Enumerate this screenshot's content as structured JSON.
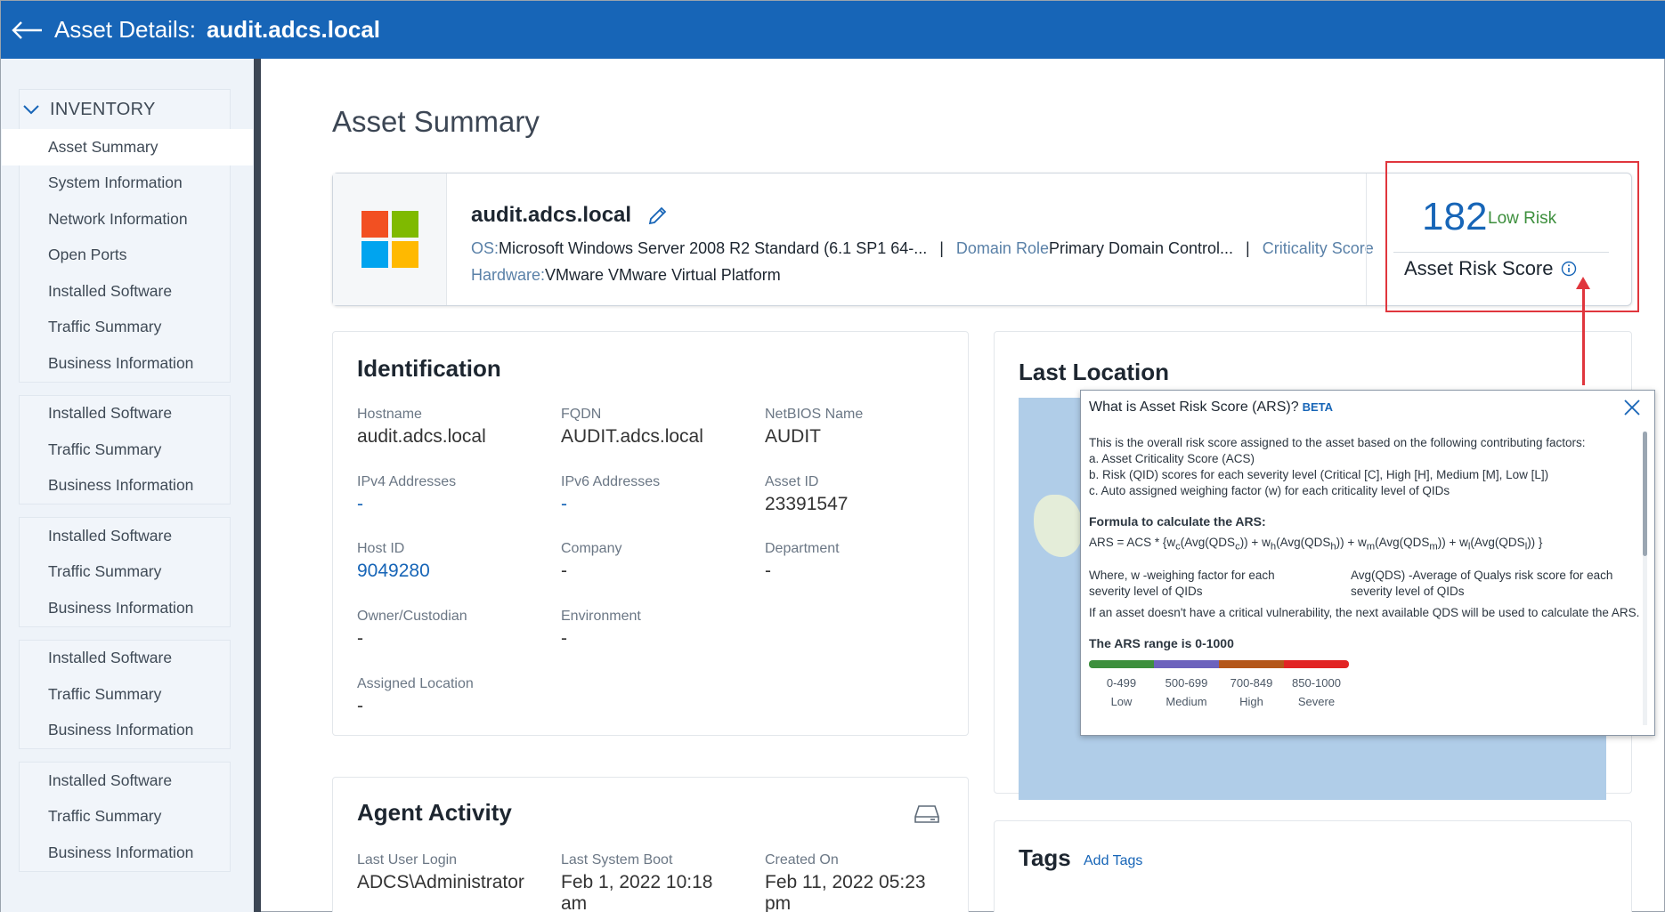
{
  "header": {
    "title": "Asset Details:",
    "host": "audit.adcs.local"
  },
  "sidebar": {
    "section": "INVENTORY",
    "primary": [
      "Asset Summary",
      "System Information",
      "Network Information",
      "Open Ports",
      "Installed Software",
      "Traffic Summary",
      "Business Information"
    ],
    "repeats": [
      [
        "Installed Software",
        "Traffic Summary",
        "Business Information"
      ],
      [
        "Installed Software",
        "Traffic Summary",
        "Business Information"
      ],
      [
        "Installed Software",
        "Traffic Summary",
        "Business Information"
      ],
      [
        "Installed Software",
        "Traffic Summary",
        "Business Information"
      ]
    ]
  },
  "page": {
    "title": "Asset Summary"
  },
  "summary": {
    "name": "audit.adcs.local",
    "os_label": "OS:",
    "os_value": "Microsoft Windows Server 2008 R2 Standard (6.1 SP1 64-...",
    "domain_label": "Domain Role",
    "domain_value": "Primary Domain Control...",
    "criticality_label": "Criticality Score",
    "hw_label": "Hardware:",
    "hw_value": "VMware VMware Virtual Platform",
    "risk_score": "182",
    "risk_level": "Low Risk",
    "risk_label": "Asset Risk Score"
  },
  "identification": {
    "title": "Identification",
    "fields": {
      "hostname": {
        "label": "Hostname",
        "value": "audit.adcs.local"
      },
      "fqdn": {
        "label": "FQDN",
        "value": "AUDIT.adcs.local"
      },
      "netbios": {
        "label": "NetBIOS Name",
        "value": "AUDIT"
      },
      "ipv4": {
        "label": "IPv4 Addresses",
        "value": "-"
      },
      "ipv6": {
        "label": "IPv6 Addresses",
        "value": "-"
      },
      "asset_id": {
        "label": "Asset ID",
        "value": "23391547"
      },
      "host_id": {
        "label": "Host ID",
        "value": "9049280"
      },
      "company": {
        "label": "Company",
        "value": "-"
      },
      "department": {
        "label": "Department",
        "value": "-"
      },
      "owner": {
        "label": "Owner/Custodian",
        "value": "-"
      },
      "environment": {
        "label": "Environment",
        "value": "-"
      },
      "location": {
        "label": "Assigned Location",
        "value": "-"
      }
    }
  },
  "agent": {
    "title": "Agent Activity",
    "last_login": {
      "label": "Last User Login",
      "value": "ADCS\\Administrator"
    },
    "last_boot": {
      "label": "Last System Boot",
      "value": "Feb 1, 2022 10:18 am"
    },
    "created": {
      "label": "Created On",
      "value": "Feb 11, 2022 05:23 pm"
    }
  },
  "last_location": {
    "title": "Last Location"
  },
  "tags": {
    "title": "Tags",
    "add": "Add Tags"
  },
  "popover": {
    "title": "What is Asset Risk Score (ARS)?",
    "beta": "BETA",
    "intro": "This is the overall risk score assigned to the asset based on the following contributing factors:",
    "factors": [
      "a. Asset Criticality Score (ACS)",
      "b. Risk (QID) scores for each severity level (Critical [C], High [H], Medium [M], Low [L])",
      "c. Auto assigned weighing factor (w) for each criticality level of QIDs"
    ],
    "formula_title": "Formula to calculate the ARS:",
    "formula_lead": "ARS = ACS * {",
    "w_label": "Where, w -weighing factor for each severity level of QIDs",
    "avg_label": "Avg(QDS) -Average of Qualys risk score for each severity level of QIDs",
    "note": "If an asset doesn't have a critical vulnerability, the next available QDS will be used to calculate the ARS.",
    "range_title": "The ARS range is 0-1000",
    "ranges": [
      {
        "range": "0-499",
        "label": "Low",
        "color": "#3d8f3d"
      },
      {
        "range": "500-699",
        "label": "Medium",
        "color": "#6c62bd"
      },
      {
        "range": "700-849",
        "label": "High",
        "color": "#b4571a"
      },
      {
        "range": "850-1000",
        "label": "Severe",
        "color": "#e22424"
      }
    ]
  },
  "colors": {
    "header": "#1765b7",
    "highlight": "#e0363d"
  }
}
